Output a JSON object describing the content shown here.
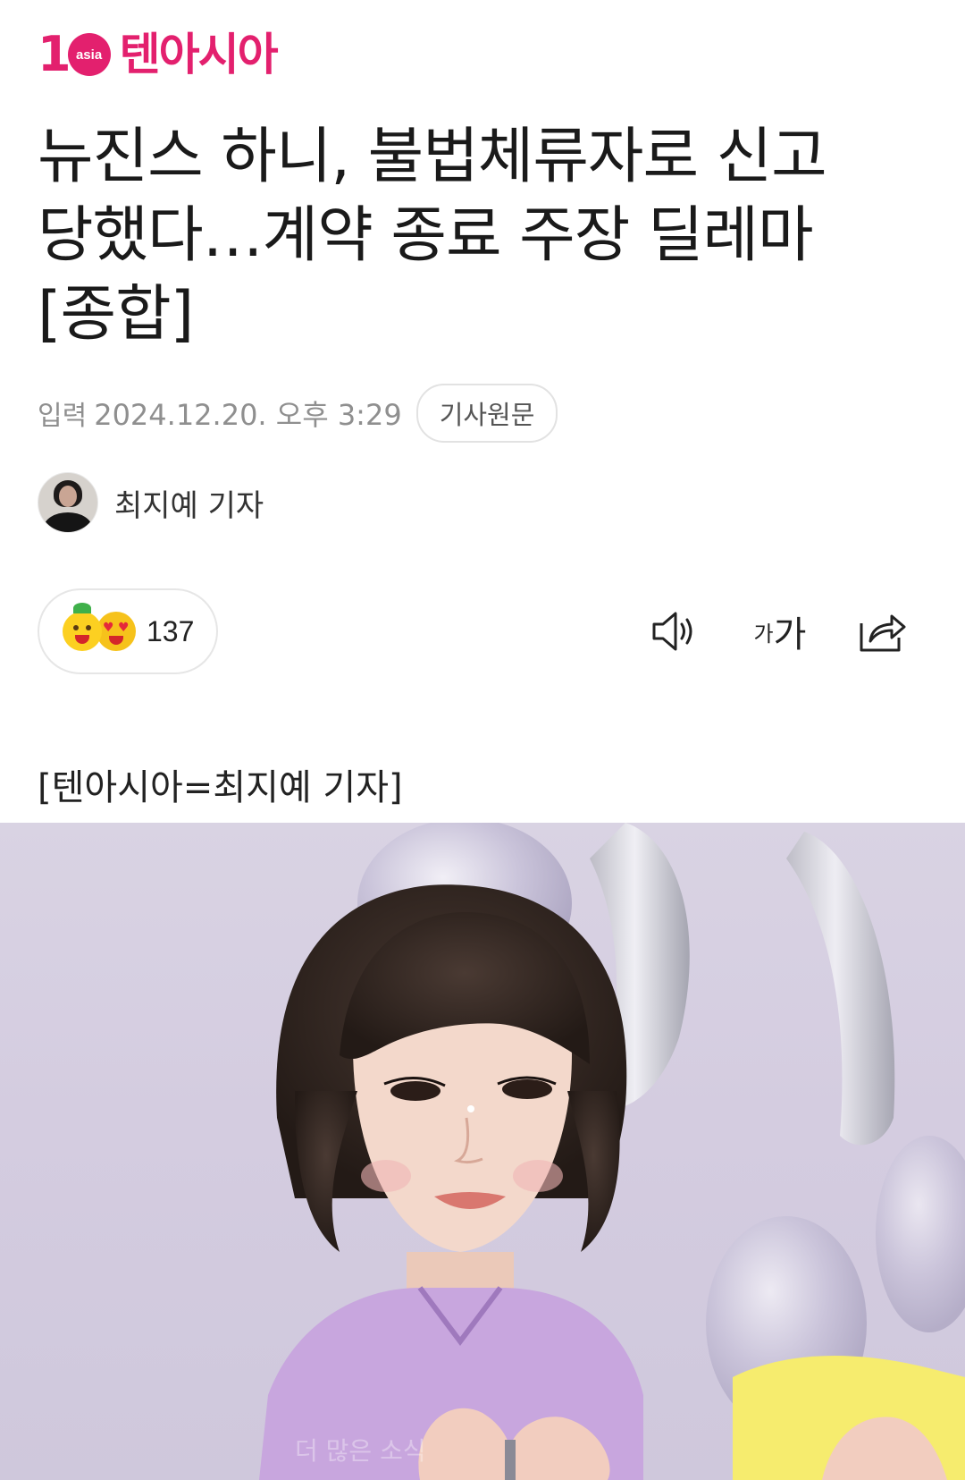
{
  "header": {
    "logo_number": "1",
    "logo_badge": "asia",
    "logo_text": "텐아시아"
  },
  "article": {
    "headline_line1": "뉴진스 하니, 불법체류자로 신고",
    "headline_line2": "당했다…계약 종료 주장 딜레마",
    "headline_line3": "[종합]",
    "published_label": "입력",
    "published_date": "2024.12.20. 오후 3:29",
    "original_article_button": "기사원문",
    "author_name": "최지예 기자",
    "byline": "[텐아시아=최지예 기자]"
  },
  "reactions": {
    "count": "137"
  },
  "toolbar": {
    "font_small": "가",
    "font_large": "가",
    "icons": [
      "speaker-icon",
      "font-size-icon",
      "share-icon"
    ]
  },
  "photo": {
    "watermark": "더 많은 소식"
  },
  "colors": {
    "brand": "#e3206e",
    "meta_text": "#8f8f8f"
  }
}
